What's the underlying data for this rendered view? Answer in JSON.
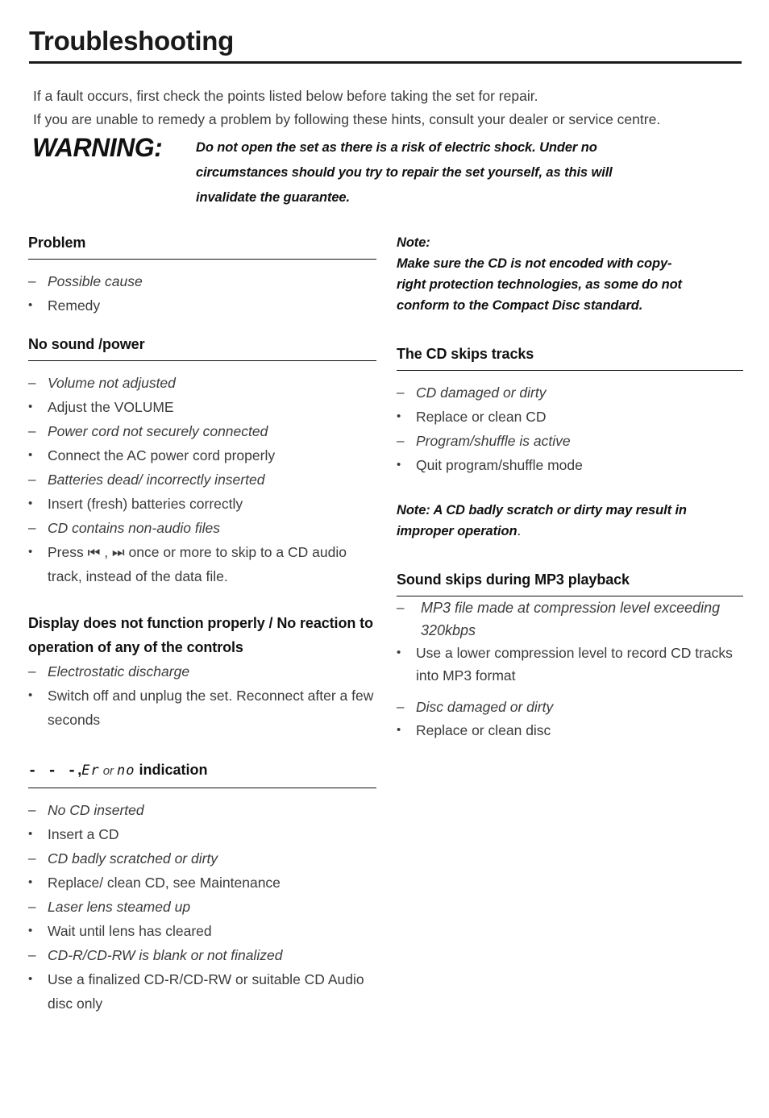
{
  "document": {
    "title": "Troubleshooting",
    "intro": [
      "If a fault occurs, first check the points listed below before taking the set for repair.",
      "If you are unable to remedy a problem by following these hints, consult your dealer or service centre."
    ],
    "warning": {
      "label": "WARNING:",
      "lines": [
        "Do not open the set as there is a risk of electric shock. Under no",
        "circumstances should you try to repair the set yourself, as this will",
        "invalidate the guarantee."
      ]
    }
  },
  "left_column": {
    "sections": [
      {
        "heading": "Problem",
        "ruled": true,
        "items": [
          {
            "type": "cause",
            "marker": "–",
            "text": "Possible cause"
          },
          {
            "type": "remedy",
            "marker": "•",
            "text": "Remedy"
          }
        ]
      },
      {
        "heading": "No sound /power",
        "ruled": true,
        "items": [
          {
            "type": "cause",
            "marker": "–",
            "text": "Volume not adjusted"
          },
          {
            "type": "remedy",
            "marker": "•",
            "text": "Adjust the VOLUME"
          },
          {
            "type": "cause",
            "marker": "–",
            "text": "Power cord not securely connected"
          },
          {
            "type": "remedy",
            "marker": "•",
            "text": "Connect the AC power cord properly"
          },
          {
            "type": "cause",
            "marker": "–",
            "text": "Batteries dead/ incorrectly inserted"
          },
          {
            "type": "remedy",
            "marker": "•",
            "text": "Insert (fresh) batteries correctly"
          },
          {
            "type": "cause",
            "marker": "–",
            "text": "CD contains non-audio files"
          },
          {
            "type": "remedy",
            "marker": "•",
            "text": "Press ⏮ , ⏭ once or more to skip to a CD audio track, instead of the data file."
          }
        ]
      },
      {
        "heading": "Display does not function properly / No reaction to operation of any of the controls",
        "ruled": false,
        "items": [
          {
            "type": "cause",
            "marker": "–",
            "text": "Electrostatic discharge"
          },
          {
            "type": "remedy",
            "marker": "•",
            "text": "Switch off and unplug the set. Reconnect after a few seconds"
          }
        ]
      },
      {
        "heading_lcd": {
          "dashes": "- - -",
          "comma": ",",
          "code_1": "Er",
          "or_word": "or",
          "code_2": "no",
          "suffix": "indication"
        },
        "ruled": true,
        "items": [
          {
            "type": "cause",
            "marker": "–",
            "text": "No CD inserted"
          },
          {
            "type": "remedy",
            "marker": "•",
            "text": "Insert a CD"
          },
          {
            "type": "cause",
            "marker": "–",
            "text": "CD badly scratched or dirty"
          },
          {
            "type": "remedy",
            "marker": "•",
            "text": "Replace/ clean CD, see Maintenance"
          },
          {
            "type": "cause",
            "marker": "–",
            "text": "Laser lens steamed up"
          },
          {
            "type": "remedy",
            "marker": "•",
            "text": "Wait until lens has cleared"
          },
          {
            "type": "cause",
            "marker": "–",
            "text": "CD-R/CD-RW is blank or not finalized"
          },
          {
            "type": "remedy",
            "marker": "•",
            "text": "Use a finalized CD-R/CD-RW or suitable CD Audio disc only"
          }
        ]
      }
    ]
  },
  "right_column": {
    "top_note": {
      "label": "Note:",
      "lines": [
        "Make sure the CD is not encoded with copy-",
        "right protection technologies, as some do not",
        "conform to the Compact Disc standard."
      ]
    },
    "sections": [
      {
        "heading": "The CD skips tracks",
        "ruled": true,
        "items": [
          {
            "type": "cause",
            "marker": "–",
            "text": "CD damaged or dirty"
          },
          {
            "type": "remedy",
            "marker": "•",
            "text": "Replace or clean CD"
          },
          {
            "type": "cause",
            "marker": "–",
            "text": "Program/shuffle is active"
          },
          {
            "type": "remedy",
            "marker": "•",
            "text": "Quit program/shuffle mode"
          }
        ]
      }
    ],
    "mid_note": {
      "bold_text": "Note: A CD badly scratch or dirty may result in improper operation",
      "trailing": "."
    },
    "mp3_section": {
      "heading": "Sound skips during MP3 playback",
      "ruled": true,
      "items": [
        {
          "type": "cause",
          "marker": "–",
          "text": "MP3 file made at compression level exceeding 320kbps"
        },
        {
          "type": "remedy",
          "marker": "•",
          "text": "Use a lower compression level to record CD tracks into MP3 format"
        },
        {
          "type": "cause",
          "marker": "–",
          "text": "Disc damaged or dirty"
        },
        {
          "type": "remedy",
          "marker": "•",
          "text": "Replace or clean disc"
        }
      ]
    }
  },
  "colors": {
    "text": "#3b3b3b",
    "heading": "#111111",
    "rule": "#111111",
    "background": "#ffffff"
  }
}
